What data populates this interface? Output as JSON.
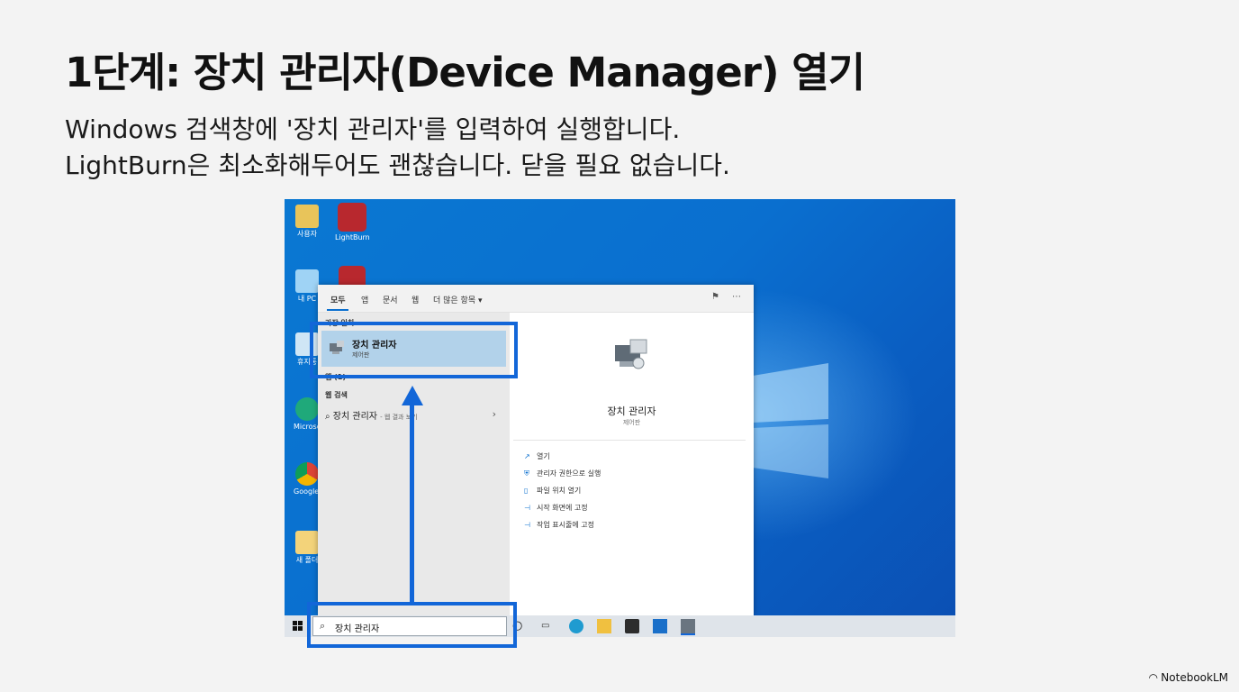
{
  "slide": {
    "title": "1단계: 장치 관리자(Device Manager) 열기",
    "subtitle_lines": [
      "Windows 검색창에 '장치 관리자'를 입력하여 실행합니다.",
      "LightBurn은 최소화해두어도 괜찮습니다. 닫을 필요 없습니다."
    ],
    "brand": "NotebookLM"
  },
  "desktop": {
    "icons": [
      {
        "label": "사용자",
        "icon": "user-folder-icon"
      },
      {
        "label": "LightBurn",
        "icon": "lightburn-icon"
      },
      {
        "label": "내 PC",
        "icon": "this-pc-icon"
      },
      {
        "label": "휴지통",
        "icon": "recycle-bin-icon"
      },
      {
        "label": "Microsoft Edge",
        "icon": "edge-icon"
      },
      {
        "label": "Google Chrome",
        "icon": "chrome-icon"
      },
      {
        "label": "새 폴더",
        "icon": "folder-icon"
      }
    ]
  },
  "start_menu": {
    "tabs": [
      "모두",
      "앱",
      "문서",
      "웹",
      "더 많은 항목"
    ],
    "best_match_section": "가장 일치",
    "best_match": {
      "name": "장치 관리자",
      "kind": "제어판",
      "icon": "device-manager-icon"
    },
    "apps_section": "앱 (1)",
    "web_section": "웹 검색",
    "web_result": {
      "query": "장치 관리자",
      "suffix": "- 웹 결과 보기",
      "icon": "search-icon"
    },
    "preview": {
      "name": "장치 관리자",
      "kind": "제어판",
      "actions": [
        {
          "label": "열기",
          "icon": "open-icon"
        },
        {
          "label": "관리자 권한으로 실행",
          "icon": "admin-icon"
        },
        {
          "label": "파일 위치 열기",
          "icon": "file-location-icon"
        },
        {
          "label": "시작 화면에 고정",
          "icon": "pin-start-icon"
        },
        {
          "label": "작업 표시줄에 고정",
          "icon": "pin-taskbar-icon"
        }
      ]
    }
  },
  "taskbar": {
    "search_value": "장치 관리자",
    "icons": [
      "windows-start-icon",
      "task-view-icon",
      "widgets-icon",
      "edge-icon",
      "file-explorer-icon",
      "store-icon",
      "mail-icon",
      "device-manager-icon"
    ]
  },
  "colors": {
    "highlight": "#1266d8",
    "desktop_blue": "#0a6fcf",
    "selection": "#b2d2ea"
  }
}
